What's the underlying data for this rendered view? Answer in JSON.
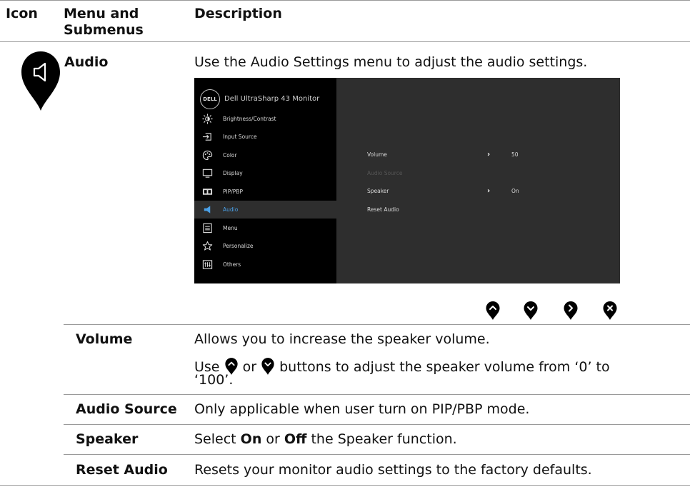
{
  "header": {
    "icon": "Icon",
    "menu": "Menu and\nSubmenus",
    "description": "Description"
  },
  "audio": {
    "name": "Audio",
    "description": "Use the Audio Settings menu to adjust the audio settings.",
    "icon": "speaker-pin-icon"
  },
  "osd": {
    "logo": "DELL",
    "title": "Dell UltraSharp 43 Monitor",
    "menu_items": [
      {
        "label": "Brightness/Contrast",
        "icon": "brightness-icon"
      },
      {
        "label": "Input Source",
        "icon": "input-source-icon"
      },
      {
        "label": "Color",
        "icon": "color-icon"
      },
      {
        "label": "Display",
        "icon": "display-icon"
      },
      {
        "label": "PIP/PBP",
        "icon": "pip-pbp-icon"
      },
      {
        "label": "Audio",
        "icon": "audio-icon",
        "active": true
      },
      {
        "label": "Menu",
        "icon": "menu-icon"
      },
      {
        "label": "Personalize",
        "icon": "star-icon"
      },
      {
        "label": "Others",
        "icon": "others-icon"
      }
    ],
    "rows": [
      {
        "label": "Volume",
        "value": "50"
      },
      {
        "label": "Audio Source",
        "value": ""
      },
      {
        "label": "Speaker",
        "value": "On"
      },
      {
        "label": "Reset Audio",
        "value": ""
      }
    ],
    "colors": {
      "left_panel": "#000000",
      "right_panel": "#2e2e2e",
      "active_label": "#4aa0e6"
    }
  },
  "nav_buttons": [
    "up-button-icon",
    "down-button-icon",
    "right-button-icon",
    "close-button-icon"
  ],
  "rows": {
    "volume": {
      "name": "Volume",
      "line1": "Allows you to increase the speaker volume.",
      "line2_a": "Use",
      "line2_b": "or",
      "line2_c": "buttons to adjust the speaker volume from ‘0’ to",
      "line3": "‘100’."
    },
    "audio_source": {
      "name": "Audio Source",
      "text": "Only applicable when user turn on PIP/PBP mode."
    },
    "speaker": {
      "name": "Speaker",
      "a": "Select",
      "b": "On",
      "c": "or",
      "d": "Off",
      "e": "the Speaker function."
    },
    "reset_audio": {
      "name": "Reset Audio",
      "text": "Resets your monitor audio settings to the factory defaults."
    }
  }
}
